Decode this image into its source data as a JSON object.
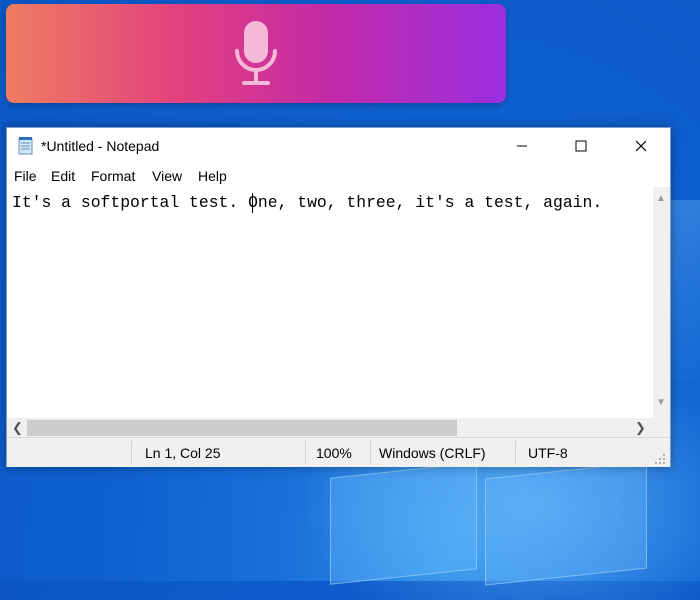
{
  "voice_typing": {
    "icon": "microphone-icon"
  },
  "notepad": {
    "title": "*Untitled - Notepad",
    "menu": [
      "File",
      "Edit",
      "Format",
      "View",
      "Help"
    ],
    "content": "It's a softportal test. One, two, three, it's a test, again.",
    "status": {
      "position": "Ln 1, Col 25",
      "zoom": "100%",
      "line_ending": "Windows (CRLF)",
      "encoding": "UTF-8"
    }
  },
  "colors": {
    "voice_gradient": [
      "#ee7d62",
      "#e2407e",
      "#c22aa8",
      "#9a2fe0"
    ],
    "desktop": "#1a6fd8"
  }
}
